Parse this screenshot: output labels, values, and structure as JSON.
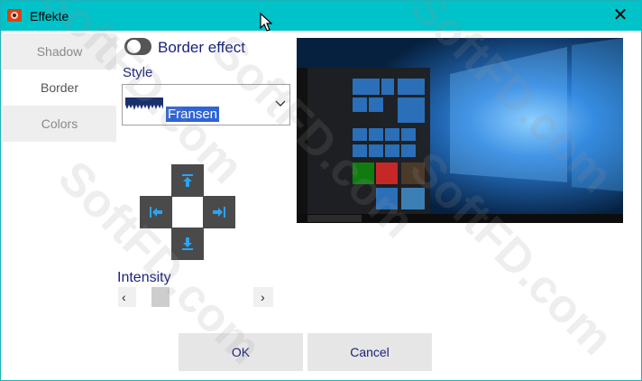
{
  "window": {
    "title": "Effekte",
    "close_glyph": "✕"
  },
  "tabs": [
    {
      "label": "Shadow",
      "active": false
    },
    {
      "label": "Border",
      "active": true
    },
    {
      "label": "Colors",
      "active": false
    }
  ],
  "border": {
    "toggle_label": "Border effect",
    "toggle_on": false,
    "style_label": "Style",
    "style_value": "Fransen",
    "intensity_label": "Intensity",
    "intensity_value": 0.15
  },
  "direction_buttons": {
    "up": "arrow-up-to-bar-icon",
    "left": "arrow-left-to-bar-icon",
    "right": "arrow-right-to-bar-icon",
    "down": "arrow-down-to-bar-icon"
  },
  "slider": {
    "left_glyph": "‹",
    "right_glyph": "›"
  },
  "buttons": {
    "ok": "OK",
    "cancel": "Cancel"
  },
  "watermark": "SoftFD.com",
  "colors": {
    "title_bar": "#00c2c9",
    "label_text": "#1a237e",
    "selection": "#2f64d6"
  }
}
